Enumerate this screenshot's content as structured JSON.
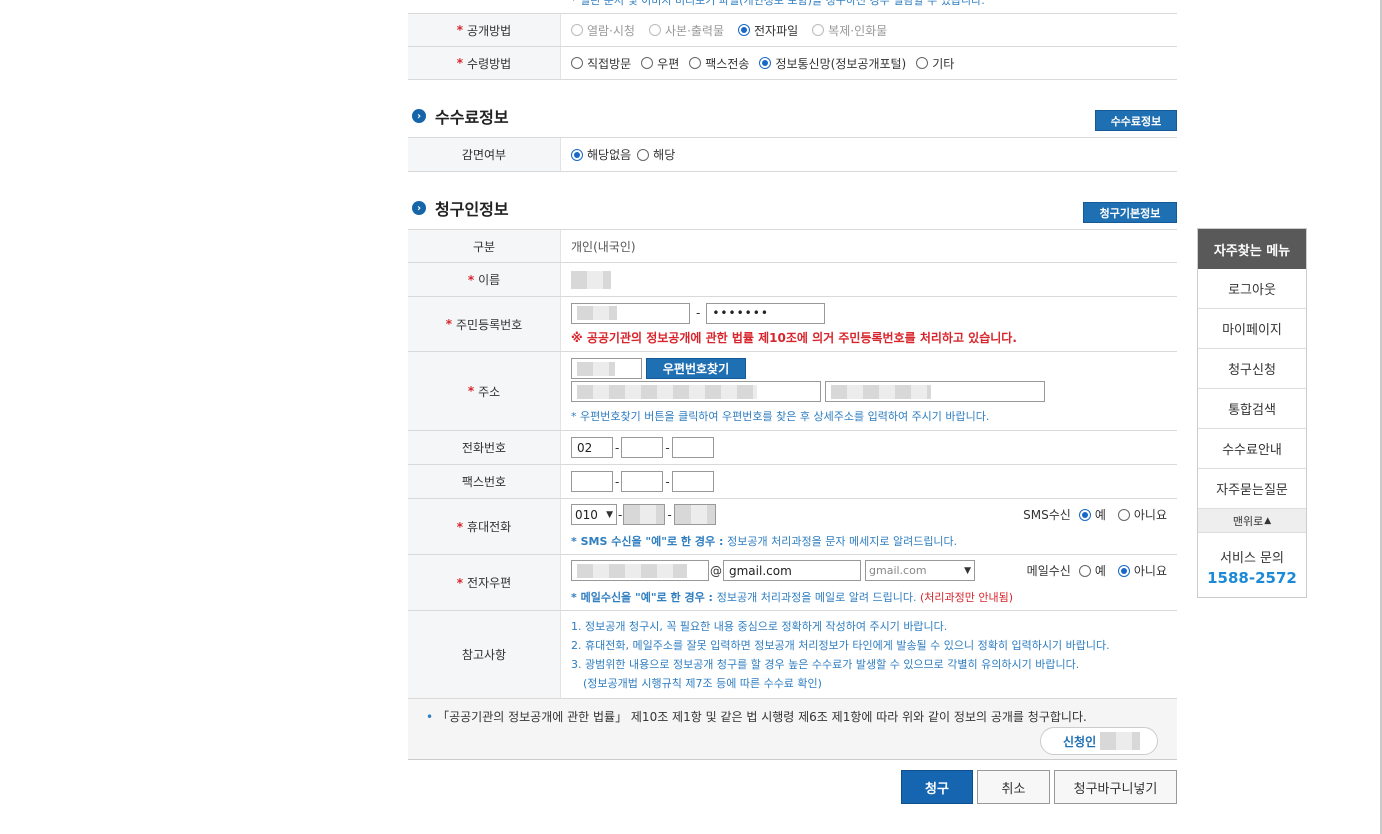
{
  "top_cut_text": "* 열린 문서 및 이미지 미리보기 파일(개인정보 포함)을 청구하신 경우 열람할 수 있습니다.",
  "disclosure_method": {
    "label": "공개방법",
    "options": [
      {
        "label": "열람·시청",
        "selected": false,
        "disabled": true
      },
      {
        "label": "사본·출력물",
        "selected": false,
        "disabled": true
      },
      {
        "label": "전자파일",
        "selected": true,
        "disabled": false
      },
      {
        "label": "복제·인화물",
        "selected": false,
        "disabled": true
      }
    ]
  },
  "receipt_method": {
    "label": "수령방법",
    "options": [
      {
        "label": "직접방문",
        "selected": false
      },
      {
        "label": "우편",
        "selected": false
      },
      {
        "label": "팩스전송",
        "selected": false
      },
      {
        "label": "정보통신망(정보공개포털)",
        "selected": true
      },
      {
        "label": "기타",
        "selected": false
      }
    ]
  },
  "fee_section": {
    "title": "수수료정보",
    "button": "수수료정보",
    "exemption_label": "감면여부",
    "options": [
      {
        "label": "해당없음",
        "selected": true
      },
      {
        "label": "해당",
        "selected": false
      }
    ]
  },
  "applicant_section": {
    "title": "청구인정보",
    "button": "청구기본정보",
    "type_label": "구분",
    "type_value": "개인(내국인)",
    "name_label": "이름",
    "rrn_label": "주민등록번호",
    "rrn_dash": "-",
    "rrn_back": "•••••••",
    "rrn_notice": "※ 공공기관의 정보공개에 관한 법률 제10조에 의거 주민등록번호를 처리하고 있습니다.",
    "address_label": "주소",
    "zip_button": "우편번호찾기",
    "address_hint": "* 우편번호찾기 버튼을 클릭하여 우편번호를 찾은 후 상세주소를 입력하여 주시기 바랍니다.",
    "phone_label": "전화번호",
    "phone_prefix": "02",
    "fax_label": "팩스번호",
    "mobile_label": "휴대전화",
    "mobile_prefix": "010",
    "sms_label": "SMS수신",
    "sms_yes": "예",
    "sms_no": "아니요",
    "sms_hint_pre": "* SMS 수신을 \"예\"로 한 경우 : ",
    "sms_hint_post": "정보공개 처리과정을 문자 메세지로 알려드립니다.",
    "email_label": "전자우편",
    "email_at": "@",
    "email_domain": "gmail.com",
    "email_select": "gmail.com",
    "mail_label": "메일수신",
    "mail_yes": "예",
    "mail_no": "아니요",
    "mail_hint_pre": "* 메일수신을 \"예\"로 한 경우 : ",
    "mail_hint_post": "정보공개 처리과정을 메일로 알려 드립니다.",
    "mail_hint_red": "(처리과정만 안내됨)",
    "notes_label": "참고사항",
    "notes": [
      "1. 정보공개 청구시, 꼭 필요한 내용 중심으로 정확하게 작성하여 주시기 바랍니다.",
      "2. 휴대전화, 메일주소를 잘못 입력하면 정보공개 처리정보가 타인에게 발송될 수 있으니 정확히 입력하시기 바랍니다.",
      "3. 광범위한 내용으로 정보공개 청구를 할 경우 높은 수수료가 발생할 수 있으므로 각별히 유의하시기 바랍니다.",
      "(정보공개법 시행규칙 제7조 등에 따른 수수료 확인)"
    ]
  },
  "declaration": "「공공기관의 정보공개에 관한 법률」 제10조 제1항 및 같은 법 시행령 제6조 제1항에 따라 위와 같이 정보의 공개를 청구합니다.",
  "applicant_badge": "신청인",
  "actions": {
    "submit": "청구",
    "cancel": "취소",
    "basket": "청구바구니넣기"
  },
  "sidebar": {
    "title": "자주찾는 메뉴",
    "items": [
      "로그아웃",
      "마이페이지",
      "청구신청",
      "통합검색",
      "수수료안내",
      "자주묻는질문"
    ],
    "top": "맨위로",
    "service_label": "서비스 문의",
    "service_phone": "1588-2572"
  }
}
